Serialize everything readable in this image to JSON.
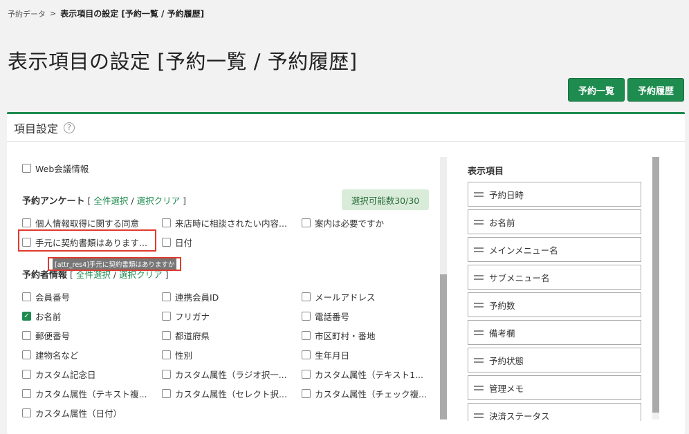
{
  "breadcrumb": {
    "parent": "予約データ",
    "separator": ">",
    "current": "表示項目の設定 [予約一覧 / 予約履歴]"
  },
  "page_title": "表示項目の設定 [予約一覧 / 予約履歴]",
  "top_buttons": {
    "reservation_list": "予約一覧",
    "reservation_history": "予約履歴"
  },
  "card": {
    "title": "項目設定",
    "help_icon": "?"
  },
  "web_meeting": {
    "label": "Web会議情報",
    "checked": false
  },
  "survey_section": {
    "title": "予約アンケート",
    "bracket_open": "[",
    "select_all": "全件選択",
    "slash": "/",
    "clear": "選択クリア",
    "bracket_close": "]",
    "badge": "選択可能数30/30",
    "items": [
      {
        "label": "個人情報取得に関する同意",
        "checked": false
      },
      {
        "label": "来店時に相談されたい内容...",
        "checked": false
      },
      {
        "label": "案内は必要ですか",
        "checked": false
      },
      {
        "label": "手元に契約書類はあります...",
        "checked": false
      },
      {
        "label": "日付",
        "checked": false
      }
    ],
    "tooltip": "[attr_res4]手元に契約書類はありますか"
  },
  "booker_section": {
    "title": "予約者情報",
    "bracket_open": "[",
    "select_all": "全件選択",
    "slash": "/",
    "clear": "選択クリア",
    "bracket_close": "]",
    "items": [
      {
        "label": "会員番号",
        "checked": false
      },
      {
        "label": "連携会員ID",
        "checked": false
      },
      {
        "label": "メールアドレス",
        "checked": false
      },
      {
        "label": "お名前",
        "checked": true
      },
      {
        "label": "フリガナ",
        "checked": false
      },
      {
        "label": "電話番号",
        "checked": false
      },
      {
        "label": "郵便番号",
        "checked": false
      },
      {
        "label": "都道府県",
        "checked": false
      },
      {
        "label": "市区町村・番地",
        "checked": false
      },
      {
        "label": "建物名など",
        "checked": false
      },
      {
        "label": "性別",
        "checked": false
      },
      {
        "label": "生年月日",
        "checked": false
      },
      {
        "label": "カスタム記念日",
        "checked": false
      },
      {
        "label": "カスタム属性（ラジオ択一...",
        "checked": false
      },
      {
        "label": "カスタム属性（テキスト1...",
        "checked": false
      },
      {
        "label": "カスタム属性（テキスト複...",
        "checked": false
      },
      {
        "label": "カスタム属性（セレクト択...",
        "checked": false
      },
      {
        "label": "カスタム属性（チェック複...",
        "checked": false
      },
      {
        "label": "カスタム属性（日付）",
        "checked": false
      }
    ]
  },
  "display_items": {
    "title": "表示項目",
    "items": [
      "予約日時",
      "お名前",
      "メインメニュー名",
      "サブメニュー名",
      "予約数",
      "備考欄",
      "予約状態",
      "管理メモ",
      "決済ステータス"
    ]
  },
  "colors": {
    "accent": "#1e8b4f",
    "highlight": "#e03a2e",
    "badge_bg": "#d9ecd9"
  }
}
